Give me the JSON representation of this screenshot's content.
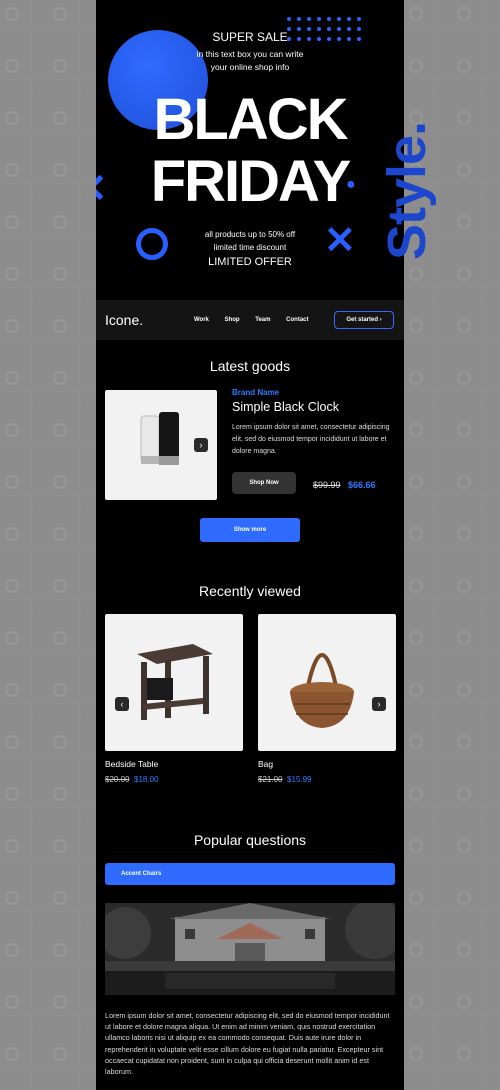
{
  "hero": {
    "super_sale": "SUPER SALE",
    "info_line1": "in this text box you can write",
    "info_line2": "your online shop info",
    "title_line1": "BLACK",
    "title_line2": "FRIDAY",
    "offer_line1": "all products up to 50% off",
    "offer_line2": "limited time discount",
    "limited_offer": "LIMITED OFFER",
    "side_word": "Style."
  },
  "nav": {
    "logo": "Icone.",
    "links": [
      "Work",
      "Shop",
      "Team",
      "Contact"
    ],
    "cta": "Get started ›"
  },
  "latest": {
    "title": "Latest goods",
    "brand": "Brand Name",
    "product_name": "Simple Black Clock",
    "description": "Lorem ipsum dolor sit amet, consectetur adipiscing elit, sed do eiusmod tempor incididunt ut labore et dolore magna.",
    "shop_now": "Shop Now",
    "old_price": "$99.99",
    "new_price": "$66.66",
    "show_more": "Show more"
  },
  "recent": {
    "title": "Recently viewed",
    "items": [
      {
        "name": "Bedside Table",
        "old_price": "$20.00",
        "new_price": "$18.00"
      },
      {
        "name": "Bag",
        "old_price": "$21.00",
        "new_price": "$15.99"
      }
    ]
  },
  "faq": {
    "title": "Popular questions",
    "accordion_label": "Accent Chairs",
    "paragraph": "Lorem ipsum dolor sit amet, consectetur adipiscing elit, sed do eiusmod tempor incididunt ut labore et dolore magna aliqua. Ut enim ad minim veniam, quis nostrud exercitation ullamco laboris nisi ut aliquip ex ea commodo consequat. Duis aute irure dolor in reprehenderit in voluptate velit esse cillum dolore eu fugiat nulla pariatur. Excepteur sint occaecat cupidatat non proident, sunt in culpa qui officia deserunt mollit anim id est laborum."
  },
  "icons": {
    "arrow_right": "arrow-right-icon",
    "arrow_left": "arrow-left-icon"
  },
  "colors": {
    "accent": "#2f6bff",
    "price": "#2f7bff",
    "background": "#000000"
  }
}
